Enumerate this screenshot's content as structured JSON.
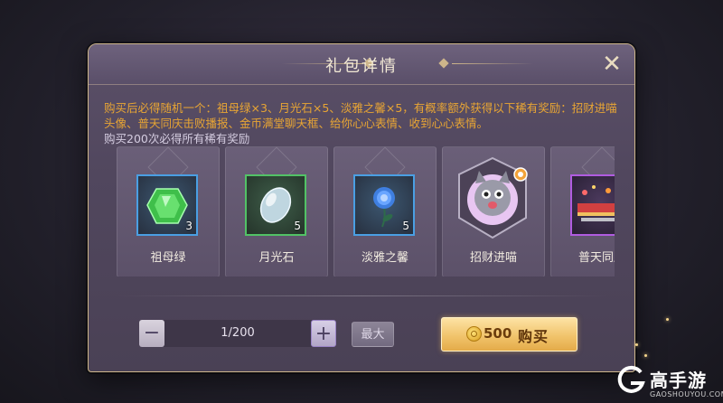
{
  "dialog": {
    "title": "礼包详情",
    "close_icon": "close-icon",
    "description_reward": "购买后必得随机一个：祖母绿×3、月光石×5、淡雅之馨×5，有概率额外获得以下稀有奖励：招财进喵头像、普天同庆击败播报、金币满堂聊天框、给你心心表情、收到心心表情。",
    "description_guarantee": "购买200次必得所有稀有奖励"
  },
  "items": [
    {
      "label": "祖母绿",
      "qty": "3",
      "icon": "emerald-gem-icon",
      "border_color": "#4a9fe3"
    },
    {
      "label": "月光石",
      "qty": "5",
      "icon": "moonstone-icon",
      "border_color": "#52c266"
    },
    {
      "label": "淡雅之馨",
      "qty": "5",
      "icon": "blue-rose-icon",
      "border_color": "#4a9fe3"
    },
    {
      "label": "招财进喵",
      "qty": "",
      "icon": "lucky-cat-avatar-icon",
      "border_color": ""
    },
    {
      "label": "普天同庆",
      "qty": "",
      "icon": "celebration-banner-icon",
      "border_color": "#b05ce0"
    }
  ],
  "purchase": {
    "minus": "−",
    "plus": "+",
    "quantity": "1/200",
    "max_label": "最大",
    "price": "500",
    "buy_label": "购买",
    "currency_icon": "gold-coin-icon"
  },
  "watermark": {
    "brand": "高手游",
    "url": "GAOSHOUYOU.COM"
  },
  "colors": {
    "accent_gold": "#cdb58a",
    "highlight_text": "#e8a534",
    "buy_button": "#f1c46c"
  }
}
